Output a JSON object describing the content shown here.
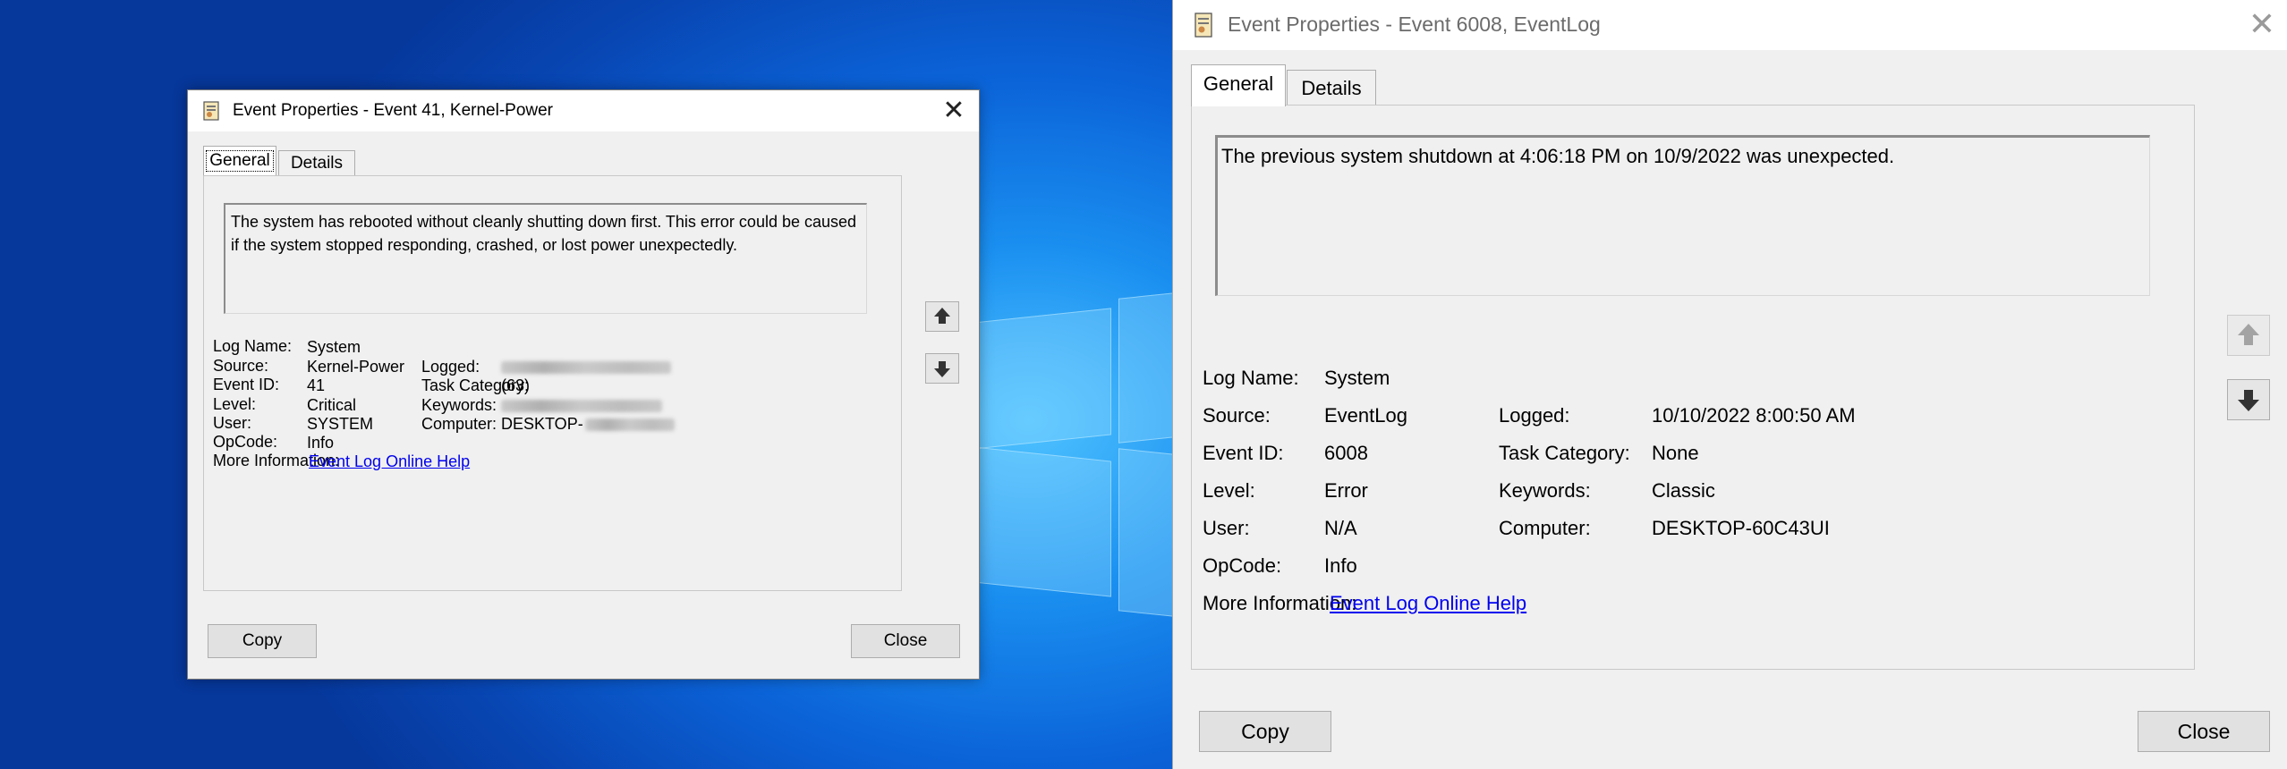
{
  "dialog_small": {
    "title": "Event Properties - Event 41, Kernel-Power",
    "tabs": [
      "General",
      "Details"
    ],
    "message": "The system has rebooted without cleanly shutting down first. This error could be caused if the system stopped responding, crashed, or lost power unexpectedly.",
    "fields": {
      "log_name_label": "Log Name:",
      "log_name": "System",
      "source_label": "Source:",
      "source": "Kernel-Power",
      "logged_label": "Logged:",
      "event_id_label": "Event ID:",
      "event_id": "41",
      "task_category_label": "Task Category:",
      "task_category": "(63)",
      "level_label": "Level:",
      "level": "Critical",
      "keywords_label": "Keywords:",
      "user_label": "User:",
      "user": "SYSTEM",
      "computer_label": "Computer:",
      "computer": "DESKTOP-",
      "opcode_label": "OpCode:",
      "opcode": "Info",
      "more_info_label": "More Information:",
      "more_info_link": "Event Log Online Help"
    },
    "buttons": {
      "copy": "Copy",
      "close": "Close"
    }
  },
  "dialog_large": {
    "title": "Event Properties - Event 6008, EventLog",
    "tabs": [
      "General",
      "Details"
    ],
    "message": "The previous system shutdown at 4:06:18 PM on 10/9/2022 was unexpected.",
    "fields": {
      "log_name_label": "Log Name:",
      "log_name": "System",
      "source_label": "Source:",
      "source": "EventLog",
      "logged_label": "Logged:",
      "logged": "10/10/2022 8:00:50 AM",
      "event_id_label": "Event ID:",
      "event_id": "6008",
      "task_category_label": "Task Category:",
      "task_category": "None",
      "level_label": "Level:",
      "level": "Error",
      "keywords_label": "Keywords:",
      "keywords": "Classic",
      "user_label": "User:",
      "user": "N/A",
      "computer_label": "Computer:",
      "computer": "DESKTOP-60C43UI",
      "opcode_label": "OpCode:",
      "opcode": "Info",
      "more_info_label": "More Information:",
      "more_info_link": "Event Log Online Help"
    },
    "buttons": {
      "copy": "Copy",
      "close": "Close"
    }
  },
  "icons": {
    "title_icon": "event-log-icon",
    "close": "close-icon",
    "up": "arrow-up-icon",
    "down": "arrow-down-icon"
  },
  "colors": {
    "link": "#0000ee",
    "desktop_blue": "#0b63d8"
  }
}
